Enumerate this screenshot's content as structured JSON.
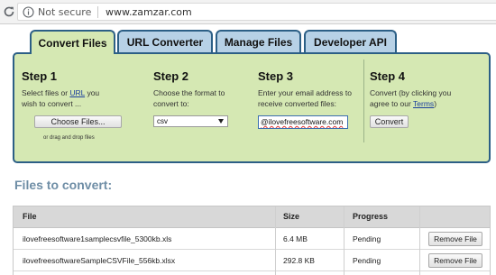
{
  "browser": {
    "security_label": "Not secure",
    "url": "www.zamzar.com"
  },
  "tabs": [
    {
      "label": "Convert Files",
      "active": true
    },
    {
      "label": "URL Converter",
      "active": false
    },
    {
      "label": "Manage Files",
      "active": false
    },
    {
      "label": "Developer API",
      "active": false
    }
  ],
  "steps": {
    "step1": {
      "title": "Step 1",
      "desc_pre": "Select files or ",
      "desc_link": "URL",
      "desc_post": " you",
      "desc_line2": "wish to convert ...",
      "button_label": "Choose Files...",
      "drag_note": "or drag and drop files"
    },
    "step2": {
      "title": "Step 2",
      "desc_line1": "Choose the format to",
      "desc_line2": "convert to:",
      "selected_format": "csv"
    },
    "step3": {
      "title": "Step 3",
      "desc_line1": "Enter your email address to",
      "desc_line2": "receive converted files:",
      "email_value": "@ilovefreesoftware.com"
    },
    "step4": {
      "title": "Step 4",
      "desc_line1": "Convert (by clicking you",
      "desc_pre": "agree to our ",
      "desc_link": "Terms",
      "desc_post": ")",
      "button_label": "Convert"
    }
  },
  "files_section": {
    "heading": "Files to convert:",
    "columns": {
      "file": "File",
      "size": "Size",
      "progress": "Progress"
    },
    "rows": [
      {
        "file": "ilovefreesoftware1samplecsvfile_5300kb.xls",
        "size": "6.4 MB",
        "progress": "Pending",
        "action": "Remove File"
      },
      {
        "file": "ilovefreesoftwareSampleCSVFile_556kb.xlsx",
        "size": "292.8 KB",
        "progress": "Pending",
        "action": "Remove File"
      }
    ]
  },
  "colors": {
    "panel_green": "#d5e8b3",
    "tab_blue": "#b7d1e6",
    "border_navy": "#2c5f86",
    "heading_blue": "#6f8ea6",
    "link_blue": "#1a3e9c"
  }
}
